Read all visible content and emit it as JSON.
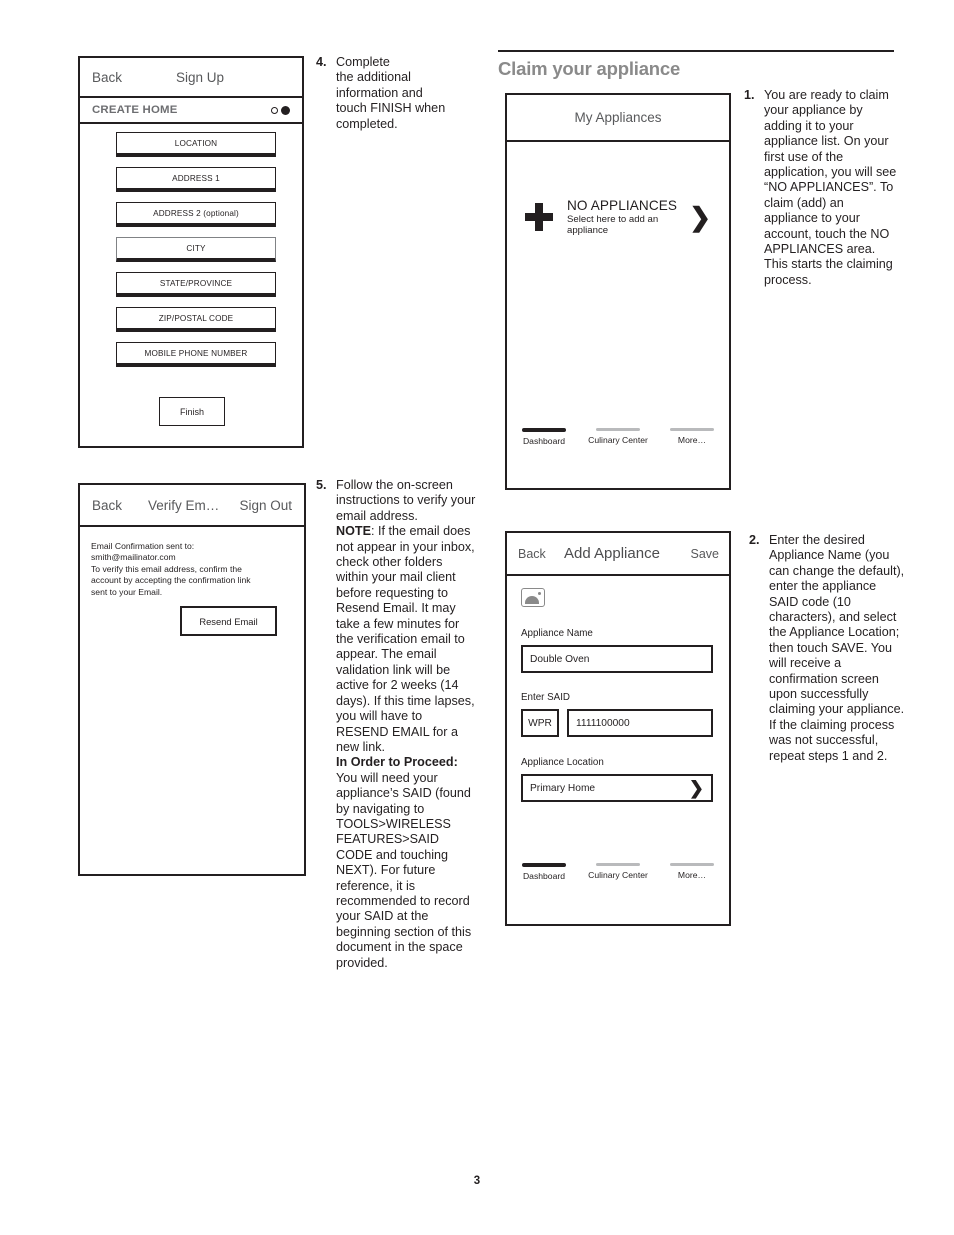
{
  "page": {
    "number": "3"
  },
  "section": {
    "title": "Claim your appliance"
  },
  "steps": {
    "s4": {
      "num": "4.",
      "lines": [
        "Complete",
        "the additional",
        "information and",
        "touch FINISH when",
        "completed."
      ]
    },
    "s5": {
      "num": "5.",
      "para1": "Follow the on-screen instructions to verify your email address.",
      "note_label": "NOTE",
      "note_body": ": If the email does not appear in your inbox, check other folders within your mail client before requesting to Resend Email. It may take a few minutes for the verification email to appear. The email validation link will be active for 2 weeks (14 days). If this time lapses, you will have to RESEND EMAIL for a new link.",
      "proceed_label": "In Order to Proceed:",
      "proceed_body": " You will need your appliance’s SAID (found by navigating to TOOLS>WIRELESS FEATURES>SAID CODE and touching NEXT). For future reference, it is recommended to record your SAID at the beginning section of this document in the space provided."
    },
    "s1": {
      "num": "1.",
      "body": "You are ready to claim your appliance by adding it to your appliance list. On your first use of the application, you will see “NO APPLIANCES”. To claim (add) an appliance to your account, touch the NO APPLIANCES area. This starts the claiming process."
    },
    "s2": {
      "num": "2.",
      "body": "Enter the desired Appliance Name (you can change the default), enter the appliance SAID code (10 characters), and select the Appliance Location; then touch SAVE. You will receive a confirmation screen upon successfully claiming your appliance. If the claiming process was not successful, repeat steps 1 and 2."
    }
  },
  "create_home_screen": {
    "nav": {
      "back": "Back",
      "title": "Sign Up"
    },
    "subhead": "CREATE HOME",
    "fields": [
      "LOCATION",
      "ADDRESS 1",
      "ADDRESS 2 (optional)",
      "CITY",
      "STATE/PROVINCE",
      "ZIP/POSTAL CODE",
      "MOBILE PHONE NUMBER"
    ],
    "finish_button": "Finish"
  },
  "verify_email_screen": {
    "nav": {
      "back": "Back",
      "title": "Verify Em…",
      "right": "Sign Out"
    },
    "body_lines": [
      "Email Confirmation sent to:",
      "smith@mailinator.com",
      "To verify this email address, confirm the",
      "account by accepting the confirmation link",
      "sent to your Email."
    ],
    "resend_button": "Resend Email"
  },
  "my_appliances_screen": {
    "nav": {
      "title": "My Appliances"
    },
    "empty_title": "NO APPLIANCES",
    "empty_sub": "Select here to add an appliance",
    "chevron": "❯",
    "tabs": [
      {
        "label": "Dashboard",
        "active": true
      },
      {
        "label": "Culinary Center",
        "active": false
      },
      {
        "label": "More…",
        "active": false
      }
    ]
  },
  "add_appliance_screen": {
    "nav": {
      "back": "Back",
      "title": "Add Appliance",
      "right": "Save"
    },
    "appliance_name_label": "Appliance Name",
    "appliance_name_value": "Double Oven",
    "said_label": "Enter SAID",
    "said_prefix": "WPR",
    "said_value": "1111100000",
    "location_label": "Appliance Location",
    "location_value": "Primary Home",
    "location_chevron": "❯",
    "tabs": [
      {
        "label": "Dashboard",
        "active": true
      },
      {
        "label": "Culinary Center",
        "active": false
      },
      {
        "label": "More…",
        "active": false
      }
    ]
  }
}
